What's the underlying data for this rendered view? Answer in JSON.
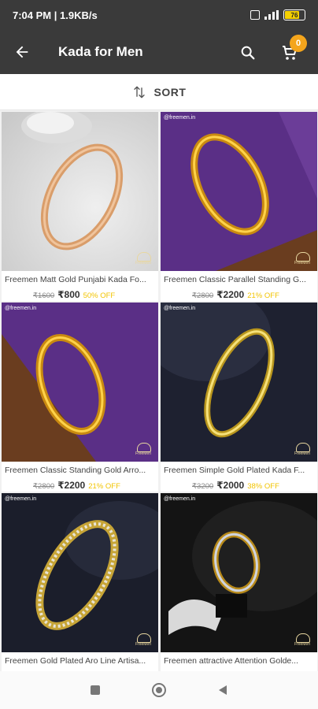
{
  "status": {
    "time_speed": "7:04 PM | 1.9KB/s",
    "battery": "76"
  },
  "toolbar": {
    "title": "Kada for Men",
    "cart_count": "0",
    "icons": [
      "back-arrow-icon",
      "search-icon",
      "cart-icon"
    ]
  },
  "sort": {
    "label": "SORT"
  },
  "products": [
    {
      "name": "Freemen Matt Gold Punjabi Kada Fo...",
      "mrp": "₹1600",
      "price": "₹800",
      "off": "50% OFF",
      "handle": "",
      "logo": "FreeMen"
    },
    {
      "name": "Freemen Classic Parallel Standing G...",
      "mrp": "₹2800",
      "price": "₹2200",
      "off": "21% OFF",
      "handle": "@freemen.in",
      "logo": "FreeMen"
    },
    {
      "name": "Freemen Classic Standing Gold Arro...",
      "mrp": "₹2800",
      "price": "₹2200",
      "off": "21% OFF",
      "handle": "@freemen.in",
      "logo": "FreeMen"
    },
    {
      "name": "Freemen Simple Gold Plated Kada F...",
      "mrp": "₹3200",
      "price": "₹2000",
      "off": "38% OFF",
      "handle": "@freemen.in",
      "logo": "FreeMen"
    },
    {
      "name": "Freemen Gold Plated Aro Line Artisa...",
      "mrp": "",
      "price": "",
      "off": "",
      "handle": "@freemen.in",
      "logo": "FreeMen"
    },
    {
      "name": "Freemen attractive Attention Golde...",
      "mrp": "",
      "price": "",
      "off": "",
      "handle": "@freemen.in",
      "logo": "FreeMen"
    }
  ],
  "colors": {
    "appbar": "#3a3a3a",
    "accent_badge": "#f4a51c",
    "discount": "#f2c400"
  }
}
